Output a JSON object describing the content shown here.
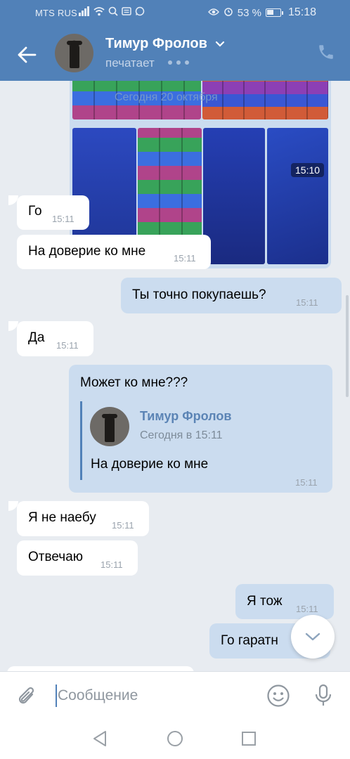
{
  "status_bar": {
    "carrier": "MTS RUS",
    "battery": "53 %",
    "battery_level": 0.53,
    "time": "15:18"
  },
  "header": {
    "contact_name": "Тимур Фролов",
    "status": "печатает"
  },
  "image_message": {
    "date_overlay": "Сегодня 20 октября",
    "time": "15:10"
  },
  "messages": [
    {
      "side": "in",
      "text": "Го",
      "time": "15:11"
    },
    {
      "side": "in",
      "text": "На доверие ко мне",
      "time": "15:11"
    },
    {
      "side": "out",
      "text": "Ты точно покупаешь?",
      "time": "15:11"
    },
    {
      "side": "in",
      "text": "Да",
      "time": "15:11"
    },
    {
      "side": "out",
      "text": "Может ко мне???",
      "time": "15:11",
      "reply": {
        "name": "Тимур Фролов",
        "date": "Сегодня в 15:11",
        "text": "На доверие ко мне"
      }
    },
    {
      "side": "in",
      "text": "Я не наебу",
      "time": "15:11"
    },
    {
      "side": "in",
      "text": "Отвечаю",
      "time": "15:11"
    },
    {
      "side": "out",
      "text": "Я тож",
      "time": "15:11"
    },
    {
      "side": "out",
      "text": "Го гаратн",
      "time": ""
    }
  ],
  "input": {
    "placeholder": "Сообщение"
  },
  "colors": {
    "header": "#5181b8",
    "incoming_bubble": "#ffffff",
    "outgoing_bubble": "#cbdcef",
    "background": "#e8ecf1"
  }
}
